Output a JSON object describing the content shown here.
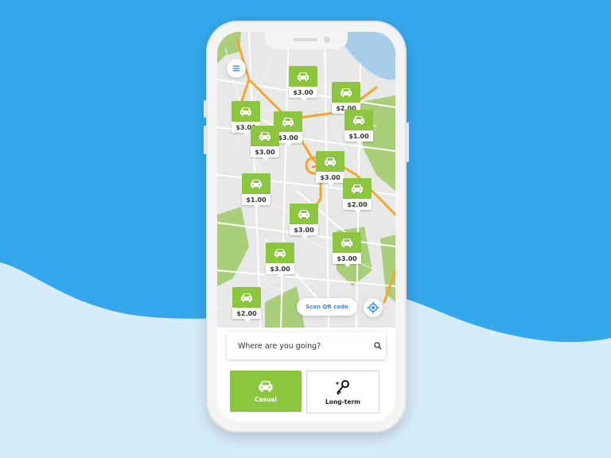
{
  "map": {
    "pins": [
      {
        "price": "$3.00"
      },
      {
        "price": "$2.00"
      },
      {
        "price": "$3.00"
      },
      {
        "price": "$3.00"
      },
      {
        "price": "$1.00"
      },
      {
        "price": "$3.00"
      },
      {
        "price": "$3.00"
      },
      {
        "price": "$1.00"
      },
      {
        "price": "$2.00"
      },
      {
        "price": "$3.00"
      },
      {
        "price": "$3.00"
      },
      {
        "price": "$3.00"
      },
      {
        "price": "$2.00"
      }
    ]
  },
  "actions": {
    "scan_label": "Scan QR code",
    "menu_icon": "hamburger-menu-icon",
    "locate_icon": "crosshair-location-icon"
  },
  "search": {
    "placeholder": "Where are you going?",
    "icon": "search-icon"
  },
  "options": {
    "casual": {
      "label": "Casual",
      "icon": "car-icon"
    },
    "longterm": {
      "label": "Long-term",
      "icon": "key-icon"
    }
  },
  "colors": {
    "accent_green": "#8cc63f",
    "accent_blue": "#2d8ee6",
    "background_blue": "#35a7ec",
    "background_light": "#d7ecfb",
    "map_roads_orange": "#f2a62c"
  }
}
